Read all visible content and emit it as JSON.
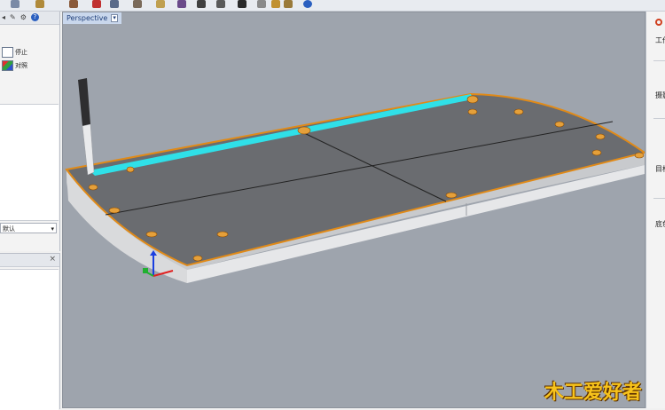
{
  "viewport": {
    "tab_label": "Perspective"
  },
  "left_panel": {
    "buttons": [
      {
        "label": "停止",
        "icon": "stop-icon"
      },
      {
        "label": "对照",
        "icon": "compare-icon"
      }
    ],
    "dropdown_value": "默认"
  },
  "right_panel": {
    "labels": [
      "工作",
      "摄影",
      "目标",
      "底色"
    ]
  },
  "watermark": {
    "text": "木工爱好者"
  },
  "colors": {
    "viewport_bg": "#9ea4ad",
    "board_top": "#6a6c70",
    "edge_highlight": "#e08a18",
    "selection_cyan": "#2fe0e8"
  }
}
